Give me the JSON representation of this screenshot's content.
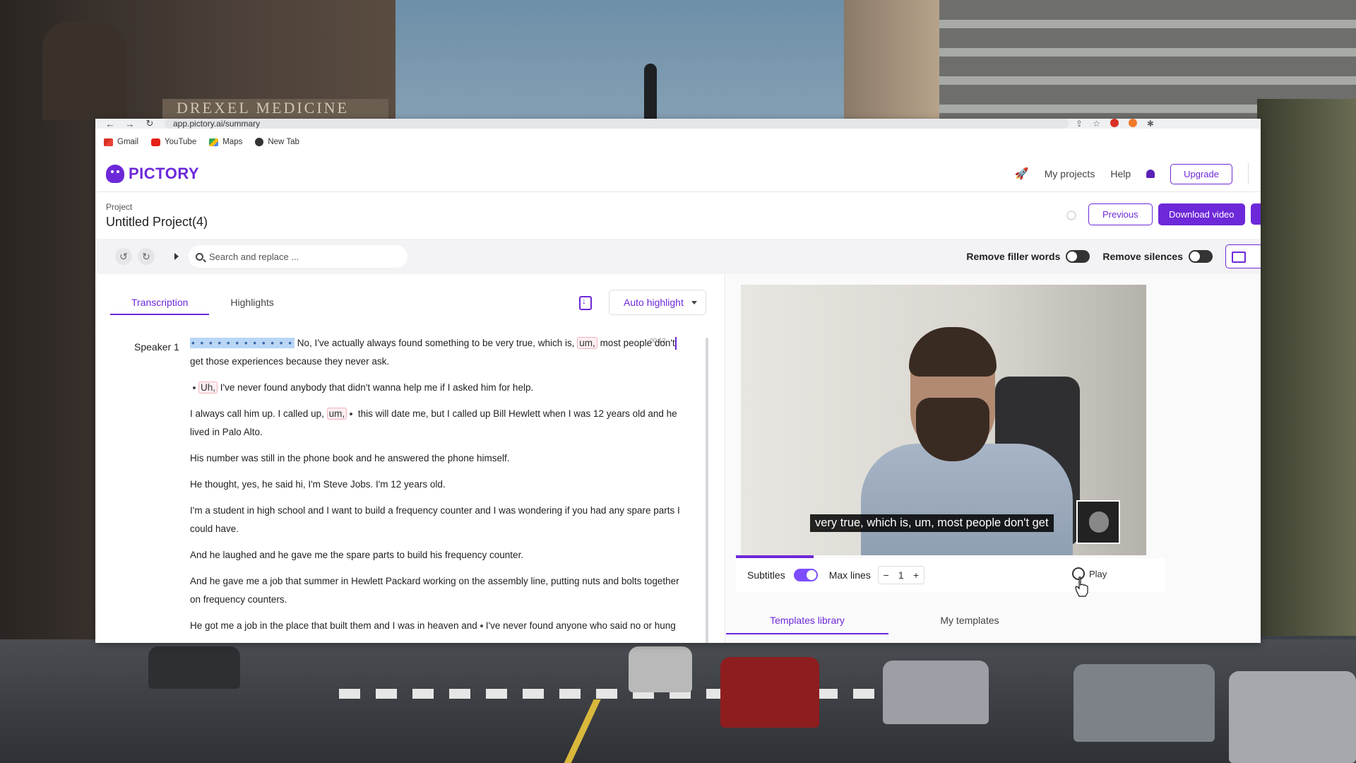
{
  "browser": {
    "url": "app.pictory.ai/summary",
    "bookmarks": [
      {
        "label": "Gmail"
      },
      {
        "label": "YouTube"
      },
      {
        "label": "Maps"
      },
      {
        "label": "New Tab"
      }
    ]
  },
  "header": {
    "logo_text": "PICTORY",
    "my_projects": "My projects",
    "help": "Help",
    "upgrade": "Upgrade"
  },
  "project": {
    "label": "Project",
    "title": "Untitled Project(4)",
    "previous": "Previous",
    "download": "Download video"
  },
  "toolbar": {
    "search_placeholder": "Search and replace ...",
    "remove_filler": "Remove filler words",
    "remove_silences": "Remove silences"
  },
  "left": {
    "tabs": [
      "Transcription",
      "Highlights"
    ],
    "auto_highlight": "Auto highlight",
    "speaker": "Speaker 1",
    "time_marker": "00:12",
    "p1_a": "No, I've actually always found something to be very true, which is,",
    "p1_filler": "um,",
    "p1_b": "most people don't",
    "p1_c": "get those experiences because they never ask.",
    "p2_filler": "Uh,",
    "p2_b": "I've never found anybody that didn't wanna help me if I asked him for help.",
    "p3_a": "I always call him up. I called up,",
    "p3_filler": "um,",
    "p3_b": "this will date me, but I called up Bill Hewlett when I was 12 years old and he lived in Palo Alto.",
    "p4": "His number was still in the phone book and he answered the phone himself.",
    "p5": "He thought, yes, he said hi, I'm Steve Jobs. I'm 12 years old.",
    "p6": "I'm a student in high school and I want to build a frequency counter and I was wondering if you had any spare parts I could have.",
    "p7": "And he laughed and he gave me the spare parts to build his frequency counter.",
    "p8": "And he gave me a job that summer in Hewlett Packard working on the assembly line, putting nuts and bolts together on frequency counters.",
    "p9_a": "He got me a job in the place that built them and I was in heaven and",
    "p9_b": "I've never found anyone who said no or hung"
  },
  "video": {
    "subtitle": "very true, which is, um, most people don't get"
  },
  "controls": {
    "subtitles": "Subtitles",
    "max_lines": "Max lines",
    "minus": "−",
    "max_lines_value": "1",
    "plus": "+",
    "play": "Play"
  },
  "templates": {
    "tabs": [
      "Templates library",
      "My templates"
    ]
  },
  "colors": {
    "brand": "#6d28d9",
    "toggle_on": "#7c4dff",
    "filler_border": "#f3b3bd",
    "pause_highlight": "#b9d6f5"
  }
}
